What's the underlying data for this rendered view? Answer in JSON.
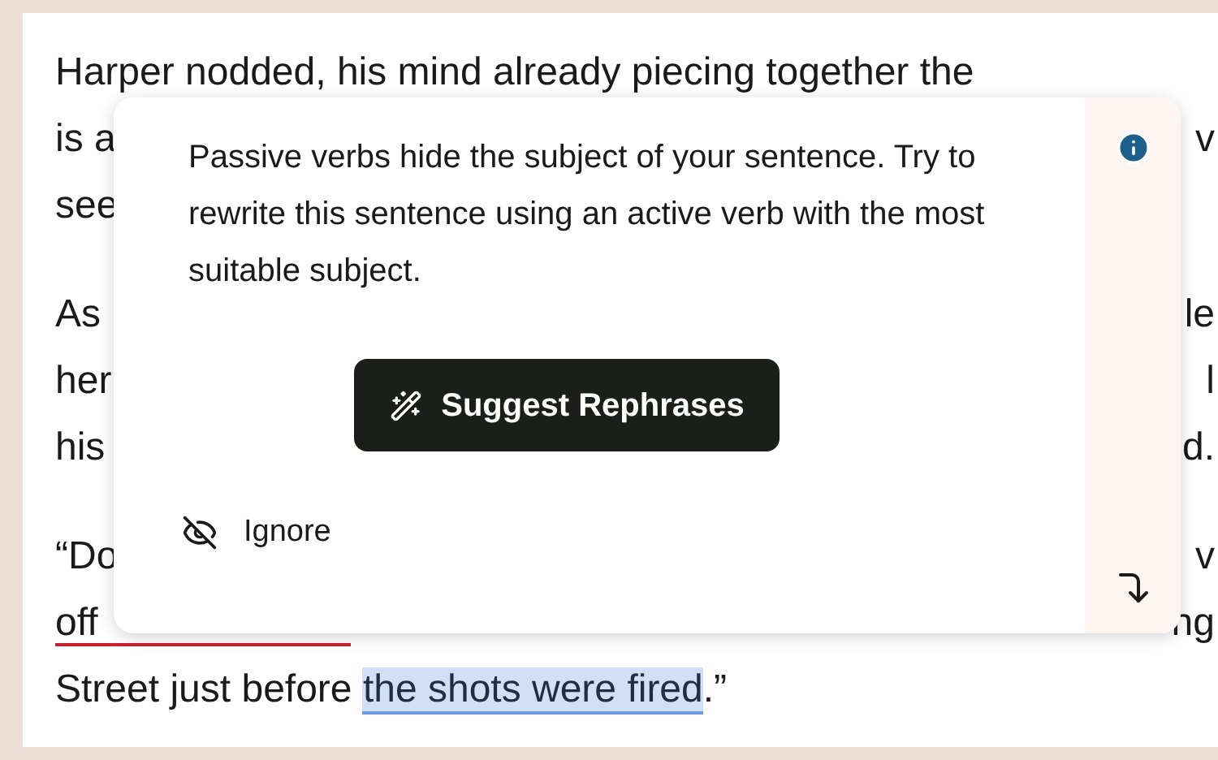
{
  "document": {
    "paragraphs": [
      {
        "lines": [
          {
            "segments": [
              {
                "text": "Harper nodded, his mind already piecing together the",
                "highlighted": false,
                "underlined": false
              }
            ]
          },
          {
            "segments": [
              {
                "text": "is a",
                "highlighted": false,
                "underlined": false
              }
            ],
            "right": "v"
          },
          {
            "segments": [
              {
                "text": "see",
                "highlighted": false,
                "underlined": false
              }
            ]
          }
        ]
      },
      {
        "lines": [
          {
            "segments": [
              {
                "text": "As",
                "highlighted": false,
                "underlined": false
              }
            ],
            "right": "le"
          },
          {
            "segments": [
              {
                "text": "her",
                "highlighted": false,
                "underlined": false
              }
            ],
            "right": "l"
          },
          {
            "segments": [
              {
                "text": "his",
                "highlighted": false,
                "underlined": false
              }
            ],
            "right": "d."
          }
        ]
      },
      {
        "lines": [
          {
            "segments": [
              {
                "text": "“Do",
                "highlighted": false,
                "underlined": false
              }
            ],
            "right": "v"
          },
          {
            "segments": [
              {
                "text": "off",
                "highlighted": false,
                "underlined": true
              }
            ],
            "right": "ng"
          },
          {
            "segments": [
              {
                "text": "Street just before ",
                "highlighted": false,
                "underlined": false
              },
              {
                "text": "the shots were fired",
                "highlighted": true,
                "underlined": false
              },
              {
                "text": ".”",
                "highlighted": false,
                "underlined": false
              }
            ]
          }
        ]
      }
    ]
  },
  "popover": {
    "message": "Passive verbs hide the subject of your sentence. Try to rewrite this sentence using an active verb with the most suitable subject.",
    "action": "Suggest Rephrases",
    "ignore": "Ignore"
  }
}
